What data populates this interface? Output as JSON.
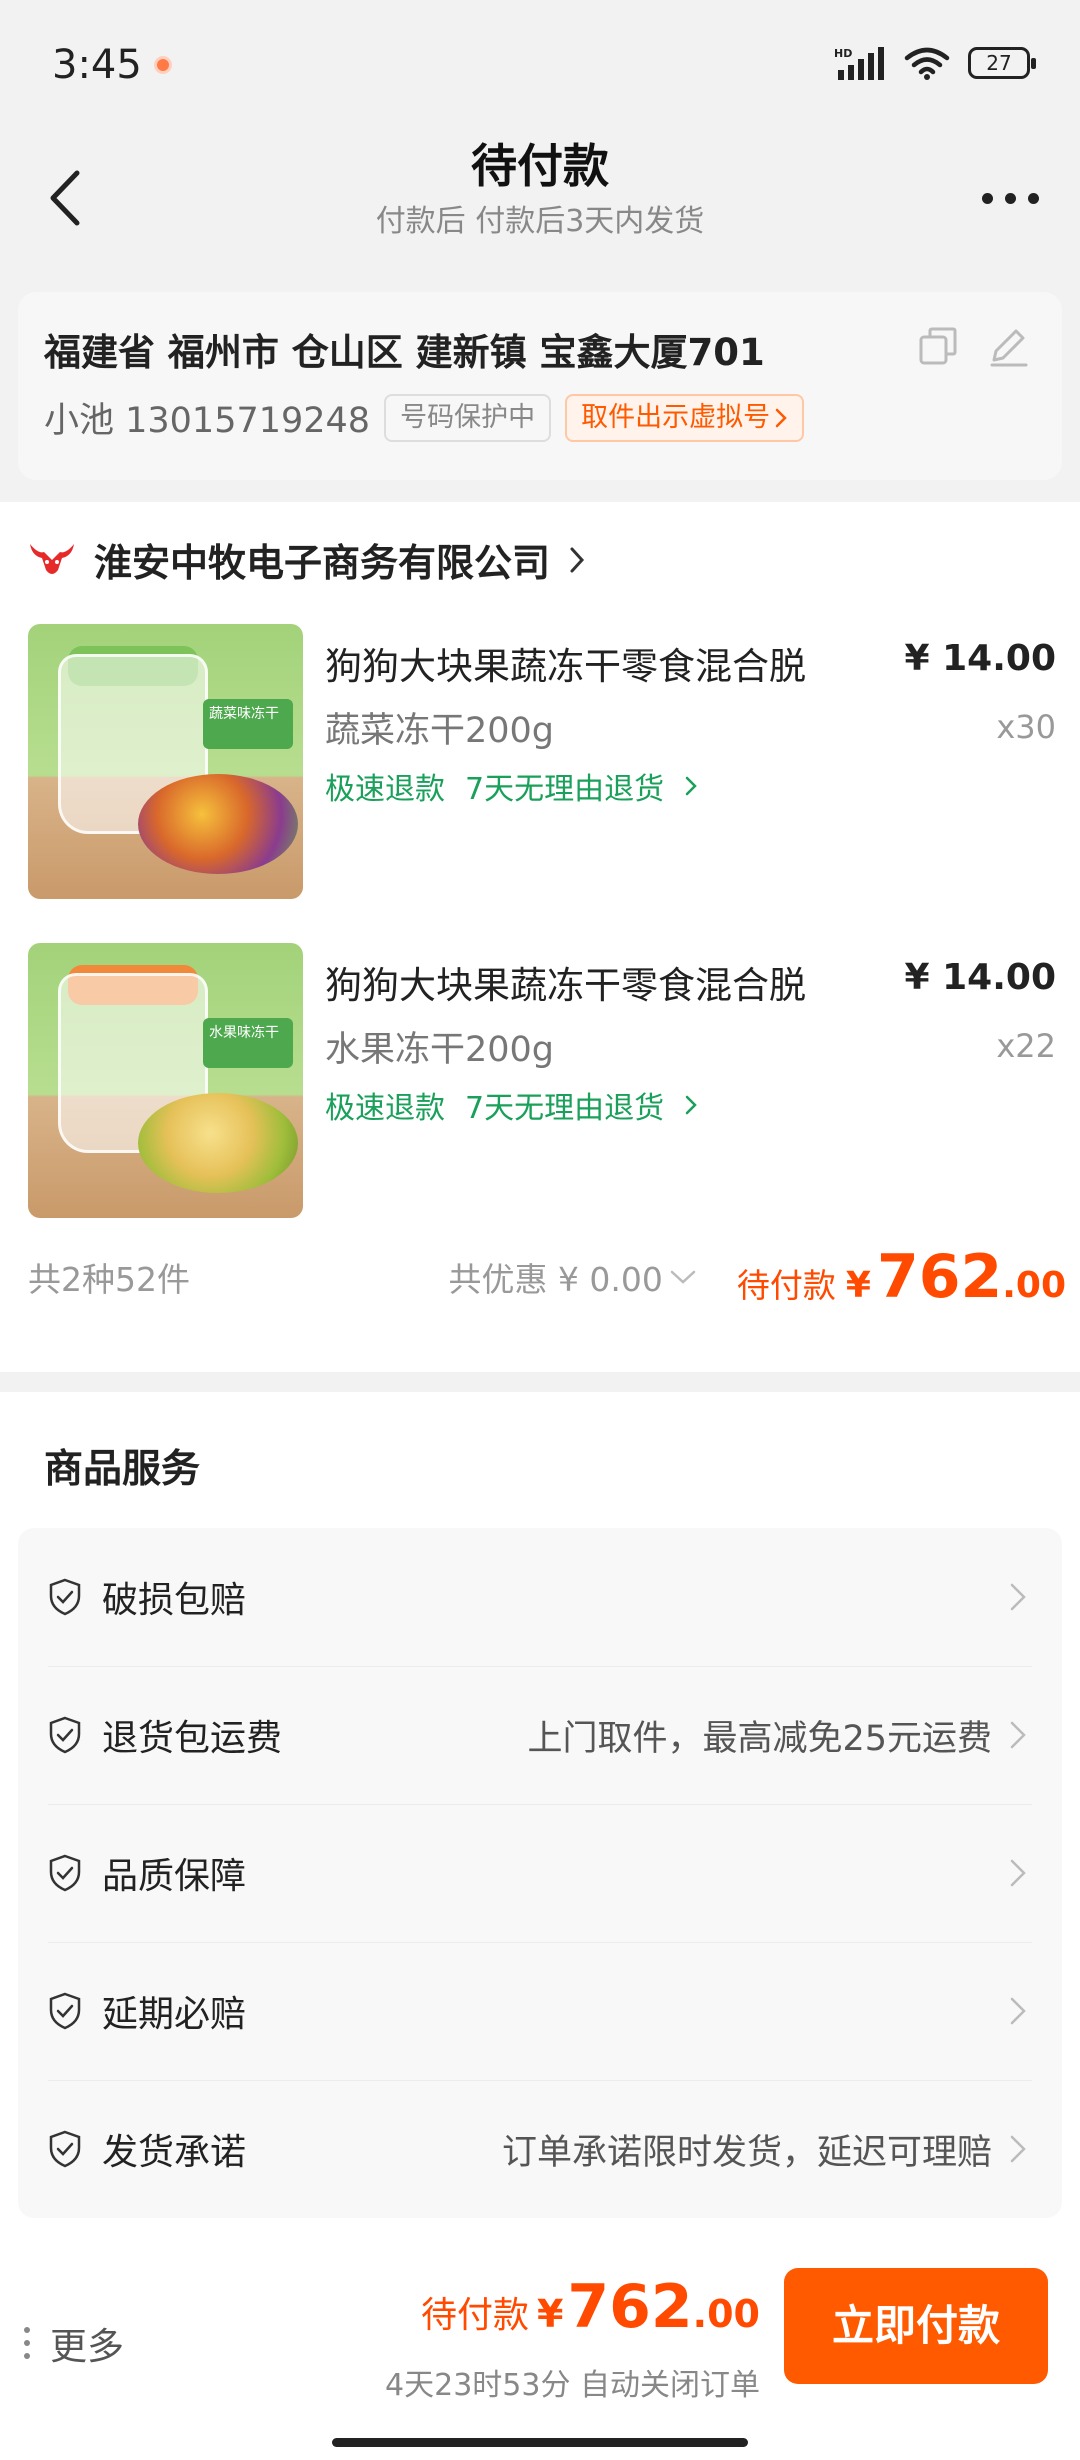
{
  "status_bar": {
    "time": "3:45",
    "battery": "27"
  },
  "nav": {
    "title": "待付款",
    "subtitle": "付款后 付款后3天内发货"
  },
  "address": {
    "line": "福建省 福州市 仓山区 建新镇 宝鑫大厦701",
    "contact": "小池 13015719248",
    "privacy_tag": "号码保护中",
    "virtual_tag": "取件出示虚拟号"
  },
  "shop": {
    "name": "淮安中牧电子商务有限公司"
  },
  "products": [
    {
      "name": "狗狗大块果蔬冻干零食混合脱",
      "price": "¥ 14.00",
      "spec": "蔬菜冻干200g",
      "qty": "x30",
      "tag_refund": "极速退款",
      "tag_return": "7天无理由退货",
      "thumb_label": "蔬菜味冻干"
    },
    {
      "name": "狗狗大块果蔬冻干零食混合脱",
      "price": "¥ 14.00",
      "spec": "水果冻干200g",
      "qty": "x22",
      "tag_refund": "极速退款",
      "tag_return": "7天无理由退货",
      "thumb_label": "水果味冻干"
    }
  ],
  "summary": {
    "count": "共2种52件",
    "discount": "共优惠 ¥ 0.00",
    "pay_label": "待付款",
    "yen": "¥",
    "amount_int": "762",
    "amount_dec": ".00"
  },
  "services": {
    "title": "商品服务",
    "items": [
      {
        "label": "破损包赔",
        "desc": ""
      },
      {
        "label": "退货包运费",
        "desc": "上门取件，最高减免25元运费"
      },
      {
        "label": "品质保障",
        "desc": ""
      },
      {
        "label": "延期必赔",
        "desc": ""
      },
      {
        "label": "发货承诺",
        "desc": "订单承诺限时发货，延迟可理赔"
      }
    ]
  },
  "bottom": {
    "more": "更多",
    "pay_label": "待付款",
    "yen": "¥",
    "amount_int": "762",
    "amount_dec": ".00",
    "countdown": "4天23时53分 自动关闭订单",
    "pay_button": "立即付款"
  },
  "colors": {
    "accent": "#ff5a00",
    "green": "#1aa05a"
  }
}
